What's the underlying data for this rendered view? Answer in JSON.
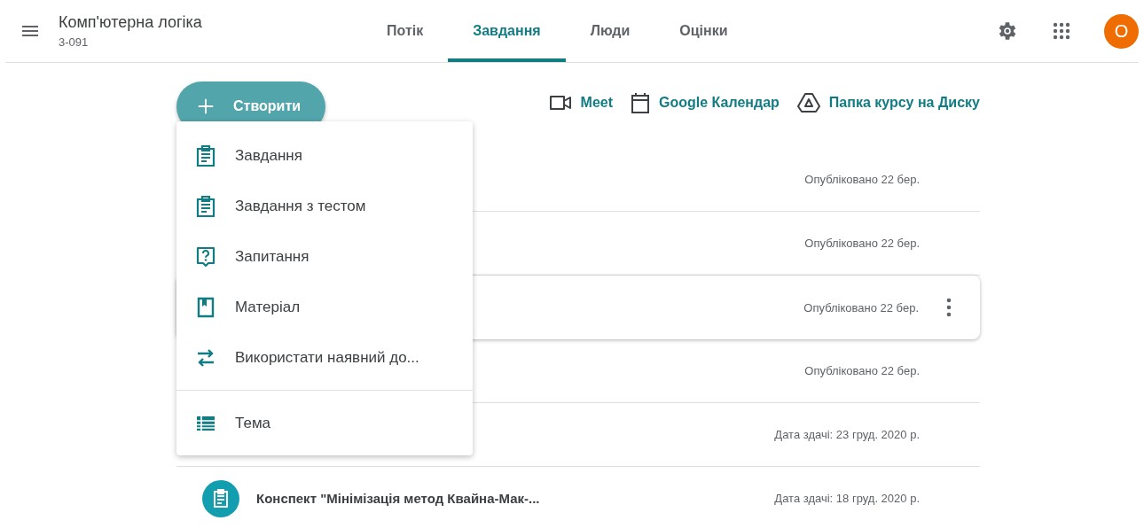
{
  "header": {
    "title": "Комп'ютерна логіка",
    "subtitle": "3-091",
    "avatar": "О"
  },
  "tabs": [
    {
      "label": "Потік",
      "selected": false
    },
    {
      "label": "Завдання",
      "selected": true
    },
    {
      "label": "Люди",
      "selected": false
    },
    {
      "label": "Оцінки",
      "selected": false
    }
  ],
  "create_button": {
    "label": "Створити"
  },
  "links": [
    {
      "kind": "meet",
      "label": "Meet"
    },
    {
      "kind": "calendar",
      "label": "Google Календар"
    },
    {
      "kind": "drive",
      "label": "Папка курсу на Диску"
    }
  ],
  "rows": [
    {
      "date": "Опубліковано 22 бер.",
      "highlighted": false
    },
    {
      "date": "Опубліковано 22 бер.",
      "highlighted": false
    },
    {
      "date": "Опубліковано 22 бер.",
      "highlighted": true
    },
    {
      "date": "Опубліковано 22 бер.",
      "highlighted": false
    },
    {
      "date": "Дата здачі: 23 груд. 2020 р.",
      "highlighted": false
    },
    {
      "title": "Конспект \"Мінімізація метод Квайна-Мак-...",
      "date": "Дата здачі: 18 груд. 2020 р.",
      "highlighted": false
    }
  ],
  "create_menu": [
    {
      "kind": "assignment",
      "label": "Завдання"
    },
    {
      "kind": "assignment",
      "label": "Завдання з тестом"
    },
    {
      "kind": "question",
      "label": "Запитання"
    },
    {
      "kind": "material",
      "label": "Матеріал"
    },
    {
      "kind": "reuse",
      "label": "Використати наявний до..."
    },
    {
      "kind": "topic",
      "label": "Тема"
    }
  ]
}
